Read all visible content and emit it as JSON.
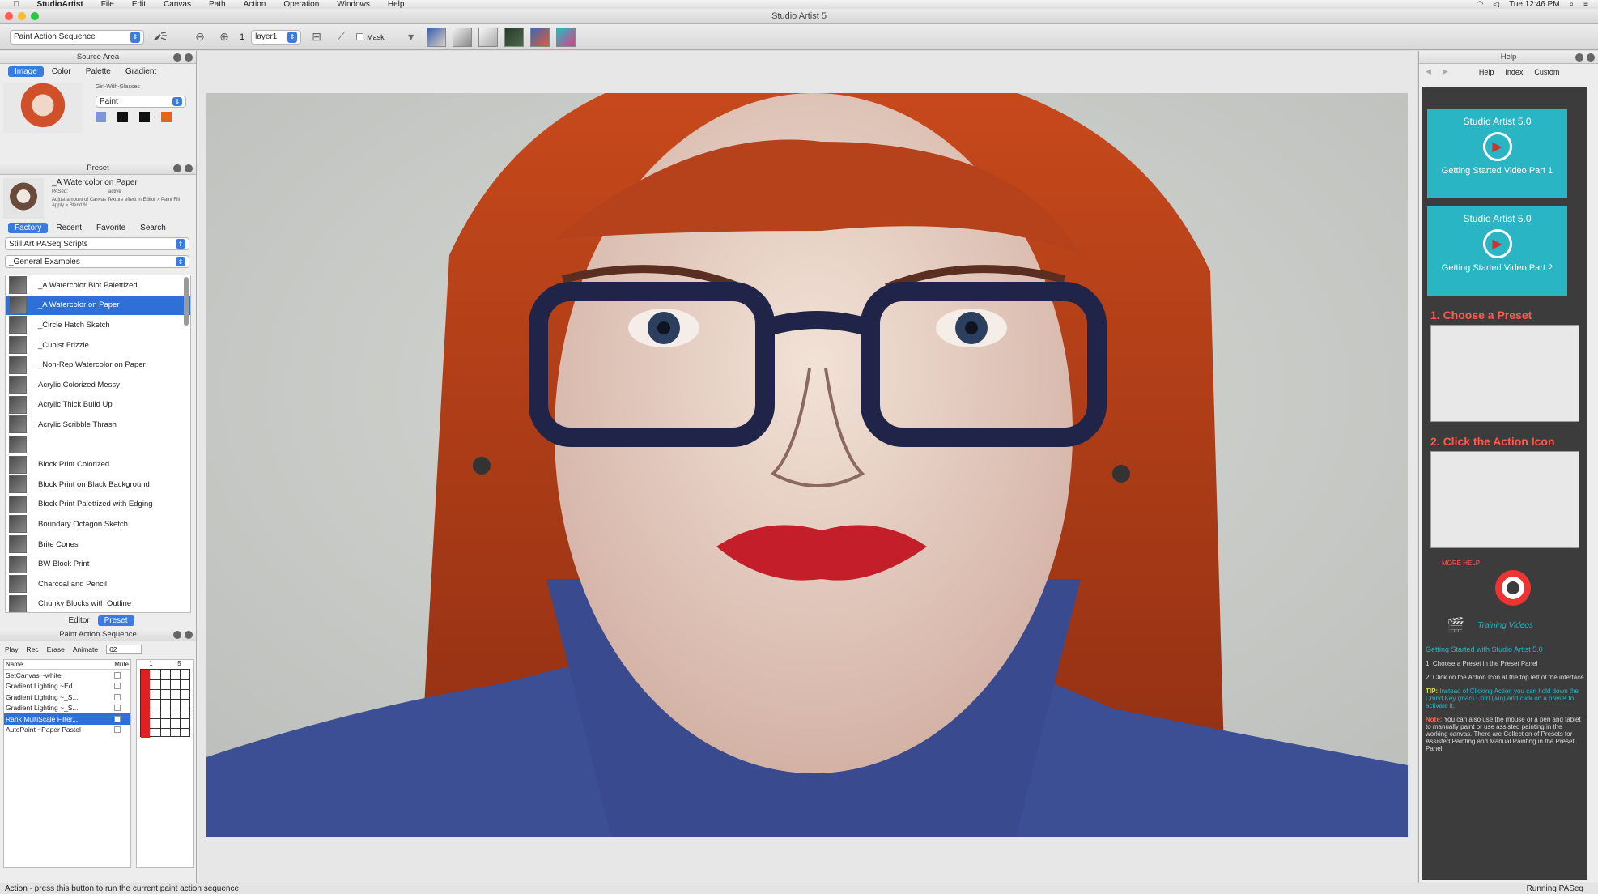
{
  "menubar": {
    "app_name": "StudioArtist",
    "items": [
      "File",
      "Edit",
      "Canvas",
      "Path",
      "Action",
      "Operation",
      "Windows",
      "Help"
    ],
    "clock": "Tue 12:46 PM"
  },
  "window": {
    "title": "Studio Artist 5"
  },
  "toolbar": {
    "mode_select": "Paint Action Sequence",
    "layer_number": "1",
    "layer_select": "layer1",
    "mask_label": "Mask"
  },
  "source_area": {
    "header": "Source Area",
    "tabs": [
      "Image",
      "Color",
      "Palette",
      "Gradient"
    ],
    "active_tab": "Image",
    "filename": "Girl-With-Glasses",
    "paint_select": "Paint",
    "swatch_colors": [
      "#7f95d8",
      "#111111",
      "#111111",
      "#e8621a"
    ]
  },
  "preset": {
    "header": "Preset",
    "current_name": "_A Watercolor on Paper",
    "paseq_label": "PASeq:",
    "paseq_value": "active",
    "description": "Adjust amount of Canvas Texture effect in Editor > Paint Fill Apply > Blend %",
    "tabs": [
      "Factory",
      "Recent",
      "Favorite",
      "Search"
    ],
    "active_tab": "Factory",
    "category_select": "Still Art PASeq Scripts",
    "group_select": "_General Examples",
    "items": [
      "_A Watercolor Blot Palettized",
      "_A Watercolor on Paper",
      "_Circle Hatch Sketch",
      "_Cubist Frizzle",
      "_Non-Rep Watercolor on Paper",
      "Acrylic Colorized Messy",
      "Acrylic Thick Build Up",
      "Acrylic Scribble Thrash",
      "",
      "Block Print Colorized",
      "Block Print on Black Background",
      "Block Print Palettized with Edging",
      "Boundary Octagon Sketch",
      "Brite Cones",
      "BW Block Print",
      "Charcoal and Pencil",
      "Chunky Blocks with Outline"
    ],
    "selected_index": 1,
    "bottom_tabs": [
      "Editor",
      "Preset"
    ],
    "active_bottom_tab": "Preset"
  },
  "pas": {
    "header": "Paint Action Sequence",
    "buttons": [
      "Play",
      "Rec",
      "Erase",
      "Animate"
    ],
    "frame_value": "62",
    "col_name": "Name",
    "col_mute": "Mute",
    "grid_labels": [
      "1",
      "5"
    ],
    "items": [
      "SetCanvas ~white",
      "Gradient Lighting ~Ed...",
      "Gradient Lighting ~_S...",
      "Gradient Lighting ~_S...",
      "Rank MultiScale Filter...",
      "AutoPaint ~Paper Pastel"
    ],
    "selected_index": 4
  },
  "help": {
    "header": "Help",
    "nav": [
      "Help",
      "Index",
      "Custom"
    ],
    "video1_title": "Studio Artist 5.0",
    "video1_caption": "Getting Started Video Part 1",
    "video2_title": "Studio Artist 5.0",
    "video2_caption": "Getting Started Video Part 2",
    "step1": "1. Choose a Preset",
    "step2": "2. Click the Action Icon",
    "more_help": "MORE HELP",
    "training": "Training Videos",
    "getting_started": "Getting Started with Studio Artist 5.0",
    "p1": "1. Choose a Preset in the Preset Panel",
    "p2": "2. Click on the Action Icon at the top left of the interface",
    "tip_label": "TIP:",
    "tip": "Instead of Clicking Action you can hold down the Cmnd Key (mac) Cntrl (win) and click on a preset to activate it.",
    "note_label": "Note:",
    "note": "You can also use the mouse or a pen and tablet to manually paint or use assisted painting in the working canvas. There are Collection of Presets for Assisted Painting and Manual Painting in the Preset Panel"
  },
  "status": {
    "hint": "Action - press this button to run the current paint action sequence",
    "running": "Running PASeq"
  }
}
